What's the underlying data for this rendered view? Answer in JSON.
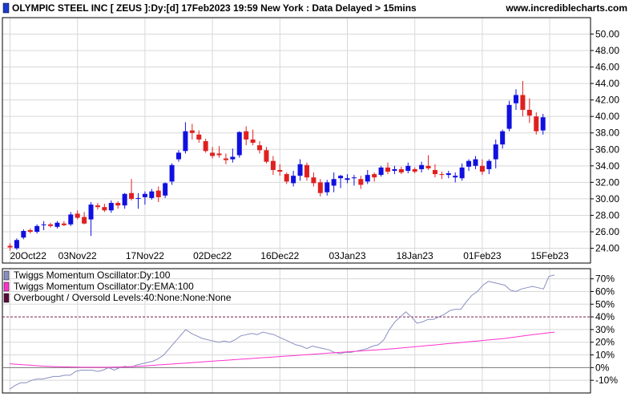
{
  "header": {
    "title": "OLYMPIC STEEL INC [ ZEUS ]:Dy:[d]  17Feb2023 19:59 New York : Data Delayed > 15mins",
    "site": "www.incrediblecharts.com"
  },
  "legend": [
    {
      "label": "Twiggs Momentum Oscillator:Dy:100",
      "color": "#8a8fc0"
    },
    {
      "label": "Twiggs Momentum Oscillator:Dy:EMA:100",
      "color": "#ff33cc"
    },
    {
      "label": "Overbought / Oversold Levels:40:None:None:None",
      "color": "#5a0a3a"
    }
  ],
  "colors": {
    "up": "#1010e0",
    "down": "#e02020",
    "tmo": "#8a8fc0",
    "ema": "#ff33cc",
    "level": "#7a1a4a"
  },
  "chart_data": [
    {
      "type": "candlestick",
      "title": "OLYMPIC STEEL INC [ ZEUS ]:Dy:[d]",
      "x_tick_labels": [
        "20Oct22",
        "03Nov22",
        "17Nov22",
        "02Dec22",
        "16Dec22",
        "03Jan23",
        "18Jan23",
        "01Feb23",
        "15Feb23"
      ],
      "x_tick_index": [
        0,
        10,
        20,
        30,
        40,
        50,
        60,
        70,
        80
      ],
      "ylim": [
        22.4,
        51.6
      ],
      "y_ticks": [
        24,
        26,
        28,
        30,
        32,
        34,
        36,
        38,
        40,
        42,
        44,
        46,
        48,
        50
      ],
      "y_tick_labels": [
        "24.00",
        "26.00",
        "28.00",
        "30.00",
        "32.00",
        "34.00",
        "36.00",
        "38.00",
        "40.00",
        "42.00",
        "44.00",
        "46.00",
        "48.00",
        "50.00"
      ],
      "ohlc": [
        [
          24.3,
          24.6,
          23.7,
          24.1
        ],
        [
          24.0,
          25.2,
          23.8,
          25.0
        ],
        [
          25.3,
          26.3,
          25.1,
          26.1
        ],
        [
          26.2,
          26.4,
          25.8,
          26.0
        ],
        [
          26.0,
          26.9,
          25.8,
          26.7
        ],
        [
          26.8,
          27.3,
          26.2,
          26.9
        ],
        [
          26.9,
          27.1,
          26.5,
          26.7
        ],
        [
          26.6,
          27.3,
          26.4,
          27.1
        ],
        [
          27.0,
          27.3,
          26.7,
          26.8
        ],
        [
          26.9,
          28.4,
          26.7,
          28.1
        ],
        [
          28.2,
          28.6,
          27.5,
          27.7
        ],
        [
          27.8,
          28.4,
          26.9,
          27.0
        ],
        [
          27.5,
          29.6,
          25.5,
          29.3
        ],
        [
          29.2,
          29.5,
          28.7,
          29.0
        ],
        [
          29.0,
          29.4,
          28.4,
          28.6
        ],
        [
          28.6,
          29.8,
          28.3,
          29.5
        ],
        [
          29.5,
          29.7,
          28.8,
          29.2
        ],
        [
          29.2,
          30.7,
          28.8,
          30.6
        ],
        [
          30.7,
          32.4,
          29.8,
          30.0
        ],
        [
          30.0,
          30.7,
          28.8,
          30.1
        ],
        [
          30.2,
          30.9,
          29.3,
          30.6
        ],
        [
          30.1,
          31.2,
          29.9,
          30.9
        ],
        [
          31.0,
          31.5,
          29.6,
          30.2
        ],
        [
          30.4,
          32.0,
          30.1,
          31.9
        ],
        [
          32.1,
          34.3,
          31.7,
          34.1
        ],
        [
          34.8,
          35.9,
          34.5,
          35.6
        ],
        [
          35.8,
          39.3,
          35.5,
          38.2
        ],
        [
          38.3,
          39.1,
          37.2,
          38.0
        ],
        [
          37.8,
          38.3,
          36.8,
          37.2
        ],
        [
          37.0,
          37.3,
          35.6,
          35.8
        ],
        [
          35.6,
          36.3,
          34.9,
          35.2
        ],
        [
          35.5,
          36.4,
          35.0,
          35.3
        ],
        [
          34.9,
          35.5,
          34.2,
          34.7
        ],
        [
          34.8,
          36.1,
          34.4,
          35.1
        ],
        [
          35.3,
          38.2,
          35.0,
          38.1
        ],
        [
          38.2,
          38.8,
          36.5,
          37.2
        ],
        [
          37.2,
          38.4,
          36.5,
          36.8
        ],
        [
          36.5,
          37.0,
          35.5,
          35.9
        ],
        [
          35.9,
          36.3,
          34.3,
          34.5
        ],
        [
          34.6,
          35.2,
          32.9,
          33.5
        ],
        [
          33.5,
          34.2,
          32.8,
          33.3
        ],
        [
          33.0,
          33.2,
          31.8,
          32.1
        ],
        [
          31.9,
          33.4,
          31.5,
          32.8
        ],
        [
          32.8,
          34.8,
          32.2,
          34.2
        ],
        [
          34.1,
          34.4,
          32.2,
          32.6
        ],
        [
          32.6,
          33.2,
          31.5,
          31.9
        ],
        [
          32.0,
          32.4,
          30.3,
          30.7
        ],
        [
          30.8,
          32.3,
          30.4,
          32.0
        ],
        [
          31.6,
          33.2,
          30.8,
          32.4
        ],
        [
          32.5,
          32.9,
          31.3,
          32.8
        ],
        [
          32.3,
          33.0,
          31.9,
          32.5
        ],
        [
          32.5,
          32.9,
          31.6,
          32.6
        ],
        [
          32.4,
          32.8,
          31.2,
          31.7
        ],
        [
          32.1,
          33.5,
          31.8,
          32.9
        ],
        [
          33.0,
          33.2,
          32.1,
          32.6
        ],
        [
          32.9,
          34.0,
          32.7,
          33.8
        ],
        [
          33.8,
          34.4,
          33.0,
          33.3
        ],
        [
          33.4,
          34.0,
          33.0,
          33.6
        ],
        [
          33.6,
          33.9,
          33.0,
          33.2
        ],
        [
          33.4,
          34.4,
          33.1,
          34.0
        ],
        [
          33.6,
          33.8,
          33.1,
          33.3
        ],
        [
          33.6,
          34.5,
          33.2,
          34.1
        ],
        [
          34.0,
          35.3,
          33.5,
          33.7
        ],
        [
          33.5,
          34.2,
          32.6,
          33.0
        ],
        [
          33.0,
          33.3,
          32.4,
          32.9
        ],
        [
          32.9,
          33.4,
          32.5,
          33.1
        ],
        [
          32.6,
          33.2,
          32.0,
          32.8
        ],
        [
          32.5,
          34.3,
          32.2,
          33.8
        ],
        [
          33.9,
          34.8,
          33.4,
          34.6
        ],
        [
          34.0,
          35.2,
          33.6,
          34.8
        ],
        [
          34.0,
          34.8,
          32.9,
          33.3
        ],
        [
          33.6,
          34.8,
          33.0,
          34.6
        ],
        [
          34.8,
          37.2,
          33.7,
          36.6
        ],
        [
          36.6,
          38.4,
          36.1,
          38.2
        ],
        [
          38.5,
          41.9,
          38.2,
          41.4
        ],
        [
          41.6,
          43.3,
          40.8,
          42.6
        ],
        [
          42.6,
          44.3,
          40.0,
          40.8
        ],
        [
          40.8,
          42.2,
          39.2,
          40.1
        ],
        [
          40.0,
          40.5,
          37.8,
          38.2
        ],
        [
          38.3,
          40.3,
          37.8,
          39.9
        ]
      ]
    },
    {
      "type": "line",
      "title": "Twiggs Momentum Oscillator",
      "ylim": [
        -20,
        78
      ],
      "y_ticks": [
        -10,
        0,
        10,
        20,
        30,
        40,
        50,
        60,
        70
      ],
      "y_tick_labels": [
        "-10%",
        "0%",
        "10%",
        "20%",
        "30%",
        "40%",
        "50%",
        "60%",
        "70%"
      ],
      "levels": [
        40
      ],
      "series": [
        {
          "name": "Twiggs Momentum Oscillator:Dy:100",
          "values": [
            -17,
            -14,
            -12,
            -12,
            -10,
            -9,
            -9,
            -8,
            -7,
            -7,
            -6,
            -6,
            -3,
            -2,
            -2,
            -2,
            -3,
            -2,
            0,
            -2,
            0,
            1,
            0,
            2,
            3,
            4,
            5,
            7,
            10,
            15,
            20,
            25,
            30,
            27,
            25,
            23,
            22,
            21,
            20,
            21,
            20,
            22,
            25,
            26,
            27,
            26,
            28,
            27,
            26,
            24,
            22,
            20,
            18,
            17,
            15,
            17,
            16,
            15,
            14,
            12,
            11,
            12,
            12,
            13,
            14,
            15,
            17,
            18,
            22,
            30,
            36,
            40,
            44,
            40,
            35,
            36,
            38,
            38,
            40,
            42,
            45,
            46,
            46,
            52,
            57,
            60,
            65,
            68,
            67,
            66,
            65,
            61,
            60,
            62,
            63,
            64,
            63,
            62,
            72,
            73
          ]
        },
        {
          "name": "Twiggs Momentum Oscillator:Dy:EMA:100",
          "values": [
            3,
            2.7,
            2.4,
            2.1,
            1.8,
            1.5,
            1.2,
            1.0,
            0.8,
            0.7,
            0.6,
            0.5,
            0.4,
            0.3,
            0.3,
            0.3,
            0.3,
            0.3,
            0.3,
            0.4,
            0.5,
            0.6,
            0.8,
            1.0,
            1.2,
            1.5,
            1.8,
            2.1,
            2.4,
            2.7,
            3.0,
            3.3,
            3.6,
            3.9,
            4.2,
            4.5,
            4.8,
            5.1,
            5.4,
            5.7,
            6.0,
            6.3,
            6.6,
            6.9,
            7.2,
            7.5,
            7.8,
            8.1,
            8.4,
            8.7,
            9.0,
            9.3,
            9.6,
            9.9,
            10.2,
            10.5,
            10.8,
            11.1,
            11.4,
            11.7,
            12.0,
            12.3,
            12.6,
            12.9,
            13.2,
            13.5,
            13.8,
            14.1,
            14.4,
            14.7,
            15.0,
            15.4,
            15.8,
            16.2,
            16.6,
            17.0,
            17.4,
            17.8,
            18.2,
            18.6,
            19.0,
            19.4,
            19.8,
            20.2,
            20.6,
            21.0,
            21.4,
            21.8,
            22.2,
            22.6,
            23.0,
            23.6,
            24.2,
            24.8,
            25.4,
            26.0,
            26.5,
            27.0,
            27.5,
            28.0
          ]
        }
      ]
    }
  ]
}
